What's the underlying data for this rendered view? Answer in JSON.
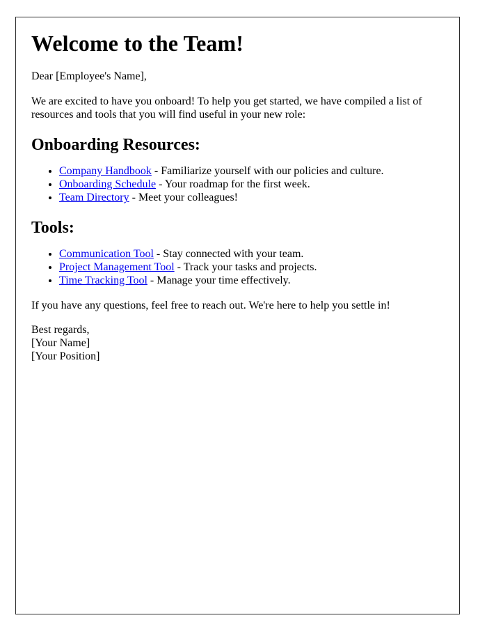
{
  "document": {
    "title": "Welcome to the Team!",
    "greeting": "Dear [Employee's Name],",
    "intro": "We are excited to have you onboard! To help you get started, we have compiled a list of resources and tools that you will find useful in your new role:",
    "sections": [
      {
        "heading": "Onboarding Resources:",
        "items": [
          {
            "link": "Company Handbook",
            "text": " - Familiarize yourself with our policies and culture."
          },
          {
            "link": "Onboarding Schedule",
            "text": " - Your roadmap for the first week."
          },
          {
            "link": "Team Directory",
            "text": " - Meet your colleagues!"
          }
        ]
      },
      {
        "heading": "Tools:",
        "items": [
          {
            "link": "Communication Tool",
            "text": " - Stay connected with your team."
          },
          {
            "link": "Project Management Tool",
            "text": " - Track your tasks and projects."
          },
          {
            "link": "Time Tracking Tool",
            "text": " - Manage your time effectively."
          }
        ]
      }
    ],
    "closing": "If you have any questions, feel free to reach out. We're here to help you settle in!",
    "signature": {
      "salutation": "Best regards,",
      "name": "[Your Name]",
      "position": "[Your Position]"
    }
  },
  "style": {
    "link_color": "#0000ee",
    "text_color": "#000000",
    "border_color": "#2b2b2b",
    "background_color": "#ffffff"
  }
}
